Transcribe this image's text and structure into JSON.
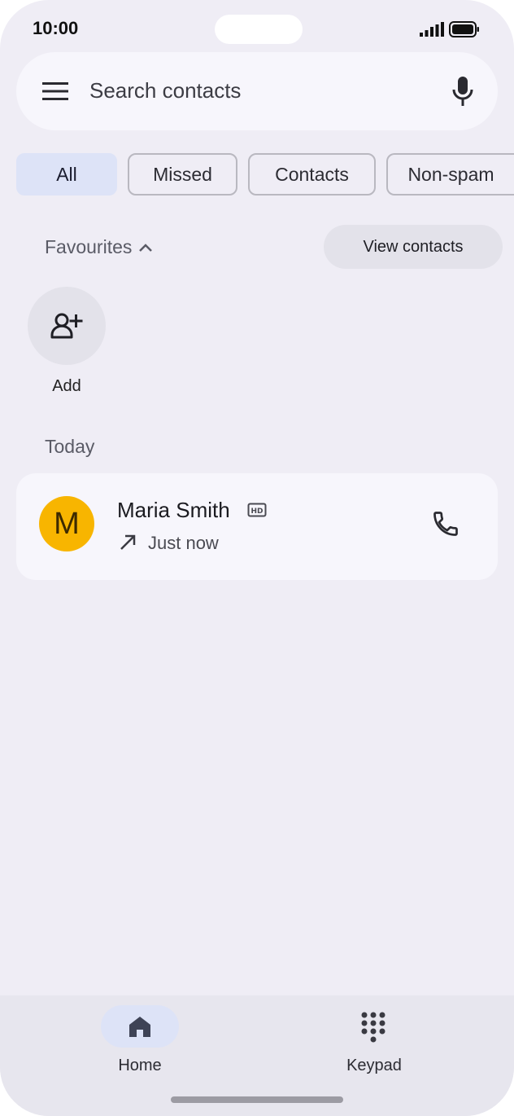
{
  "status": {
    "time": "10:00"
  },
  "search": {
    "placeholder": "Search contacts"
  },
  "filters": [
    {
      "label": "All",
      "active": true
    },
    {
      "label": "Missed",
      "active": false
    },
    {
      "label": "Contacts",
      "active": false
    },
    {
      "label": "Non-spam",
      "active": false
    }
  ],
  "favourites": {
    "label": "Favourites",
    "view_contacts_label": "View contacts",
    "add_label": "Add"
  },
  "sections": {
    "today_label": "Today"
  },
  "calls": [
    {
      "initial": "M",
      "name": "Maria Smith",
      "time": "Just now",
      "avatar_color": "#f8b500",
      "direction": "outgoing",
      "hd": true
    }
  ],
  "nav": {
    "home_label": "Home",
    "keypad_label": "Keypad"
  },
  "colors": {
    "background": "#efedf5",
    "active_chip": "#dde3f7",
    "avatar": "#f8b500"
  }
}
